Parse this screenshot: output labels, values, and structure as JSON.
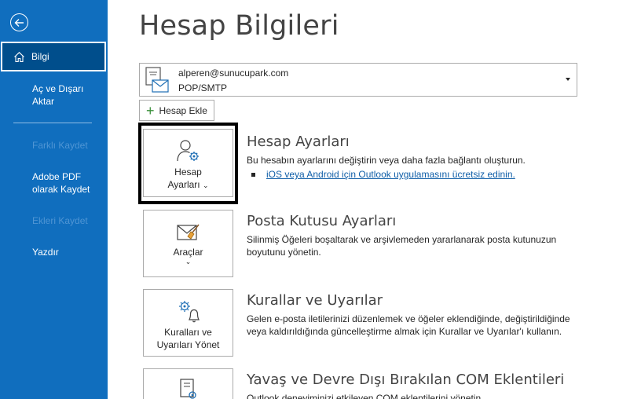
{
  "sidebar": {
    "items": [
      {
        "label": "Bilgi"
      },
      {
        "label": "Aç ve Dışarı Aktar"
      },
      {
        "label": "Farklı Kaydet"
      },
      {
        "label": "Adobe PDF olarak Kaydet"
      },
      {
        "label": "Ekleri Kaydet"
      },
      {
        "label": "Yazdır"
      }
    ]
  },
  "header": {
    "title": "Hesap Bilgileri"
  },
  "account": {
    "email": "alperen@sunucupark.com",
    "type": "POP/SMTP"
  },
  "add_account": {
    "label": "Hesap Ekle"
  },
  "sections": [
    {
      "tile_line1": "Hesap",
      "tile_line2": "Ayarları",
      "title": "Hesap Ayarları",
      "desc": "Bu hesabın ayarlarını değiştirin veya daha fazla bağlantı oluşturun.",
      "link": "iOS veya Android için Outlook uygulamasını ücretsiz edinin."
    },
    {
      "tile_line1": "Araçlar",
      "title": "Posta Kutusu Ayarları",
      "desc": "Silinmiş Öğeleri boşaltarak ve arşivlemeden yararlanarak posta kutunuzun boyutunu yönetin."
    },
    {
      "tile_line1": "Kuralları ve",
      "tile_line2": "Uyarıları Yönet",
      "title": "Kurallar ve Uyarılar",
      "desc": "Gelen e-posta iletilerinizi düzenlemek ve öğeler eklendiğinde, değiştirildiğinde veya kaldırıldığında güncelleştirme almak için Kurallar ve Uyarılar'ı kullanın."
    },
    {
      "title": "Yavaş ve Devre Dışı Bırakılan COM Eklentileri",
      "desc": "Outlook deneyiminizi etkileyen COM eklentilerini yönetin."
    }
  ],
  "colors": {
    "sidebar": "#106ebe",
    "sidebar_active": "#004e8c",
    "link": "#0f5ea8",
    "add_plus": "#3a8f3a"
  }
}
